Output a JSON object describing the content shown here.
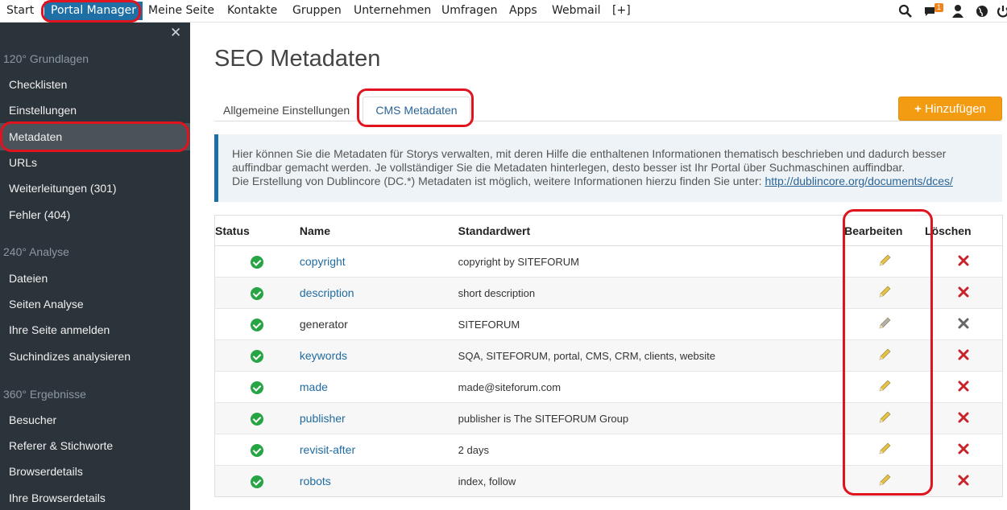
{
  "nav": {
    "items": [
      "Start",
      "Portal Manager",
      "Meine Seite",
      "Kontakte",
      "Gruppen",
      "Unternehmen",
      "Umfragen",
      "Apps",
      "Webmail",
      "[+]"
    ],
    "notification_count": "1"
  },
  "sidebar": {
    "sections": [
      {
        "title": "120° Grundlagen",
        "items": [
          "Checklisten",
          "Einstellungen",
          "Metadaten",
          "URLs",
          "Weiterleitungen (301)",
          "Fehler (404)"
        ]
      },
      {
        "title": "240° Analyse",
        "items": [
          "Dateien",
          "Seiten Analyse",
          "Ihre Seite anmelden",
          "Suchindizes analysieren"
        ]
      },
      {
        "title": "360° Ergebnisse",
        "items": [
          "Besucher",
          "Referer & Stichworte",
          "Browserdetails",
          "Ihre Browserdetails"
        ]
      }
    ]
  },
  "main": {
    "title": "SEO Metadaten",
    "tabs": [
      "Allgemeine Einstellungen",
      "CMS Metadaten"
    ],
    "add_button": "Hinzufügen",
    "info_line1": "Hier können Sie die Metadaten für Storys verwalten, mit deren Hilfe die enthaltenen Informationen thematisch beschrieben und dadurch besser",
    "info_line2": "auffindbar gemacht werden. Je vollständiger Sie die Metadaten hinterlegen, desto besser ist Ihr Portal über Suchmaschinen auffindbar.",
    "info_line3": "Die Erstellung von Dublincore (DC.*) Metadaten ist möglich, weitere Informationen hierzu finden Sie unter: ",
    "info_link": "http://dublincore.org/documents/dces/",
    "table": {
      "headers": [
        "Status",
        "Name",
        "Standardwert",
        "Bearbeiten",
        "Löschen"
      ],
      "rows": [
        {
          "name": "copyright",
          "value": "copyright by SITEFORUM"
        },
        {
          "name": "description",
          "value": "short description"
        },
        {
          "name": "generator",
          "value": "SITEFORUM"
        },
        {
          "name": "keywords",
          "value": "SQA, SITEFORUM, portal, CMS, CRM, clients, website"
        },
        {
          "name": "made",
          "value": "made@siteforum.com"
        },
        {
          "name": "publisher",
          "value": "publisher is The SITEFORUM Group"
        },
        {
          "name": "revisit-after",
          "value": "2 days"
        },
        {
          "name": "robots",
          "value": "index, follow"
        }
      ]
    }
  }
}
